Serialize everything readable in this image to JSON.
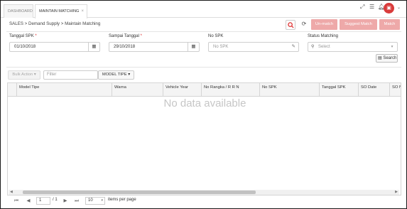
{
  "tabs": [
    {
      "label": "DASHBOARD"
    },
    {
      "label": "MAINTAIN MATCHING",
      "close": "×"
    }
  ],
  "header_icons": [
    "expand-icon",
    "menu-icon",
    "bell-icon",
    "avatar",
    "chevron-down-icon"
  ],
  "breadcrumb": "SALES > Demand Supply > Maintain Matching",
  "actions": {
    "unmatch_label": "Un-match",
    "suggest_label": "Suggest Match",
    "match_label": "Match"
  },
  "filters": {
    "tanggal_spk": {
      "label": "Tanggal SPK",
      "value": "01/10/2018"
    },
    "sampai_tanggal": {
      "label": "Sampai Tanggal",
      "value": "29/10/2018"
    },
    "no_spk": {
      "label": "No SPK",
      "placeholder": "No SPK"
    },
    "status_matching": {
      "label": "Status Matching",
      "placeholder": "Select"
    },
    "search_label": "Search"
  },
  "toolbar": {
    "bulk_action_label": "Bulk Action",
    "filter_placeholder": "Filter",
    "model_tipe_label": "MODEL TIPE"
  },
  "grid": {
    "columns": [
      "Model Tipe",
      "Warna",
      "Vehicle Year",
      "No Rangka / R R N",
      "No SPK",
      "Tanggal SPK",
      "SO Date",
      "SO N"
    ],
    "empty_text": "No data available"
  },
  "pager": {
    "page": "1",
    "of_text": "/ 1",
    "page_size": "10",
    "items_per_page_label": "items per page"
  },
  "colors": {
    "accent_red": "#d33b3b",
    "disabled_action": "#eea9a9"
  }
}
